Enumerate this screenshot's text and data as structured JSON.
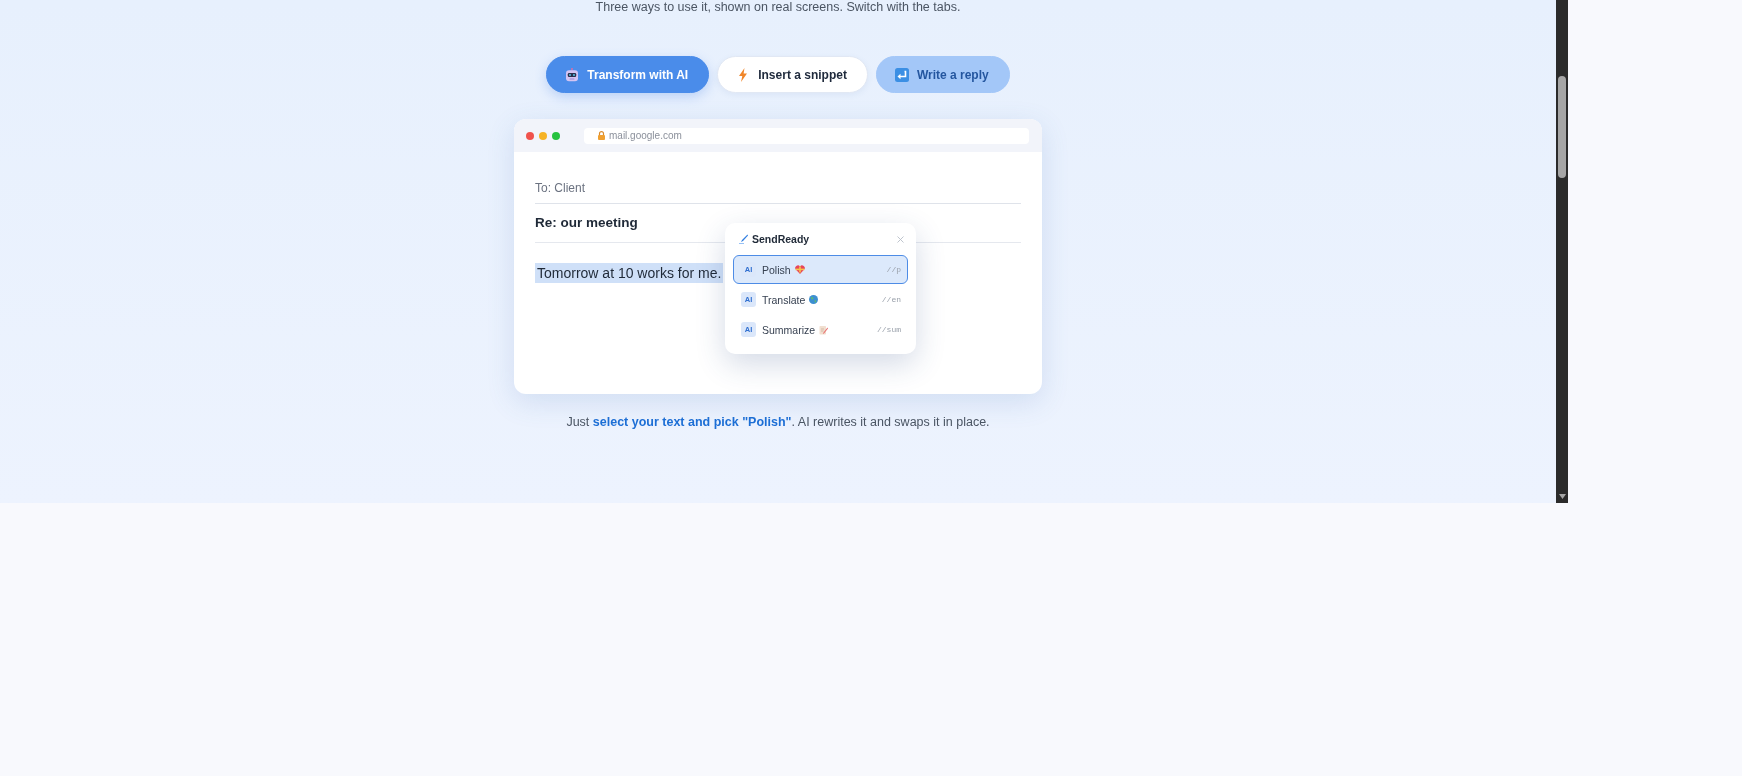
{
  "intro": {
    "text": "Three ways to use it, shown on real screens. Switch with the tabs."
  },
  "tabs": [
    {
      "label": "Transform with AI",
      "selected": true,
      "highlighted": false
    },
    {
      "label": "Insert a snippet",
      "selected": false,
      "highlighted": false
    },
    {
      "label": "Write a reply",
      "selected": false,
      "highlighted": true
    }
  ],
  "browser": {
    "address": "mail.google.com",
    "email": {
      "recipient": "To: Client",
      "subject": "Re: our meeting",
      "body": "Tomorrow at 10 works for me.",
      "body_selected": true
    }
  },
  "popup": {
    "title": "SendReady",
    "items": [
      {
        "badge": "AI",
        "label": "Polish",
        "shortcut": "//p",
        "selected": true
      },
      {
        "badge": "AI",
        "label": "Translate",
        "shortcut": "//en",
        "selected": false
      },
      {
        "badge": "AI",
        "label": "Summarize",
        "shortcut": "//sum",
        "selected": false
      }
    ]
  },
  "caption": "Just **select your text and pick \"Polish\"**. AI rewrites it and swaps it in place."
}
